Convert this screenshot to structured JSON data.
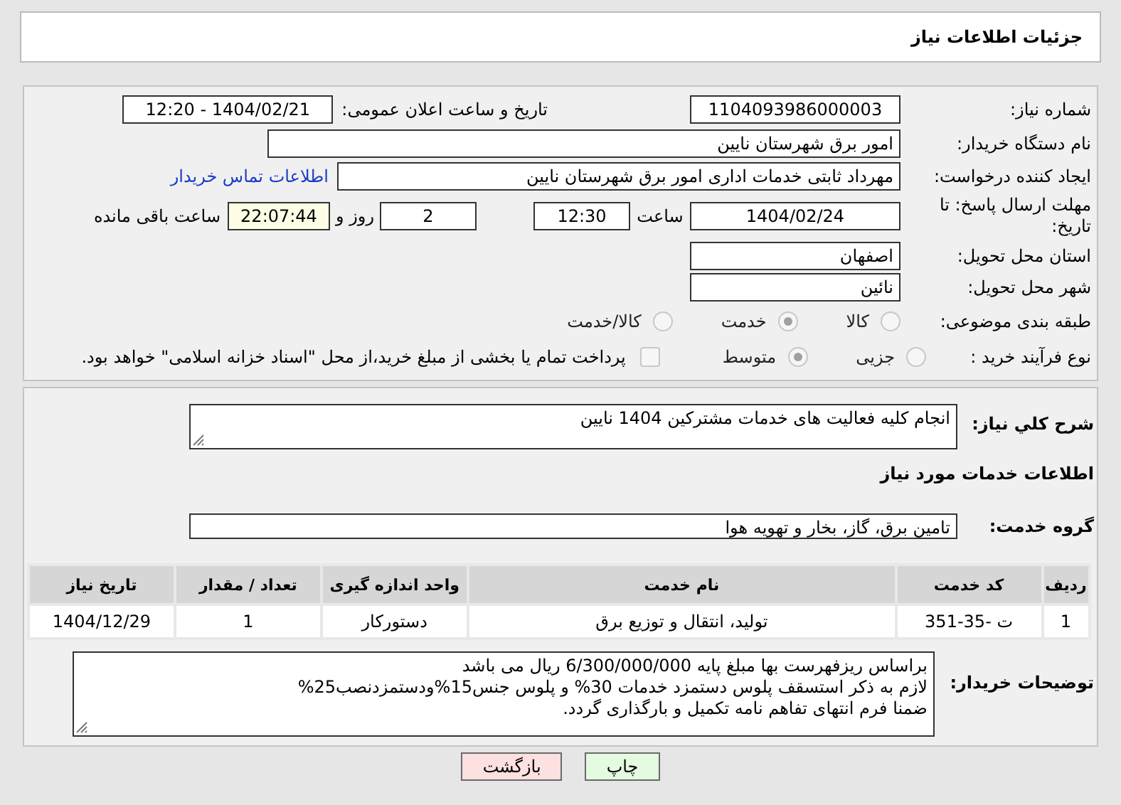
{
  "header": {
    "title": "جزئیات اطلاعات نیاز"
  },
  "need_details": {
    "need_number": {
      "label": "شماره نیاز:",
      "value": "1104093986000003"
    },
    "announce_datetime": {
      "label": "تاریخ و ساعت اعلان عمومی:",
      "value": "1404/02/21 - 12:20"
    },
    "buyer_org": {
      "label": "نام دستگاه خریدار:",
      "value": "امور برق شهرستان نایین"
    },
    "requester": {
      "label": "ایجاد کننده درخواست:",
      "value": "مهرداد ثابتی خدمات اداری امور برق شهرستان نایین",
      "contact_link": "اطلاعات تماس خریدار"
    },
    "deadline": {
      "label": "مهلت ارسال پاسخ: تا تاریخ:",
      "date": "1404/02/24",
      "time_label": "ساعت",
      "time": "12:30",
      "days": "2",
      "days_label": "روز و",
      "remaining": "22:07:44",
      "remaining_label": "ساعت باقی مانده"
    },
    "province": {
      "label": "استان محل تحویل:",
      "value": "اصفهان"
    },
    "city": {
      "label": "شهر محل تحویل:",
      "value": "نائین"
    },
    "category": {
      "label": "طبقه بندی موضوعی:",
      "options": [
        {
          "label": "کالا",
          "selected": false
        },
        {
          "label": "خدمت",
          "selected": true
        },
        {
          "label": "کالا/خدمت",
          "selected": false
        }
      ]
    },
    "purchase_process": {
      "label": "نوع فرآیند خرید :",
      "options": [
        {
          "label": "جزیی",
          "selected": false
        },
        {
          "label": "متوسط",
          "selected": true
        }
      ],
      "treasury_payment": {
        "label": "پرداخت تمام یا بخشی از مبلغ خرید،از محل \"اسناد خزانه اسلامی\" خواهد بود.",
        "checked": false
      }
    }
  },
  "need_summary": {
    "label": "شرح کلي نیاز:",
    "value": "انجام کلیه فعالیت های خدمات مشترکین 1404 نایین"
  },
  "services": {
    "title": "اطلاعات خدمات مورد نیاز",
    "group": {
      "label": "گروه خدمت:",
      "value": "تامین برق، گاز، بخار و تهویه هوا"
    },
    "table": {
      "columns": [
        "ردیف",
        "کد خدمت",
        "نام خدمت",
        "واحد اندازه گیری",
        "تعداد / مقدار",
        "تاریخ نیاز"
      ],
      "rows": [
        [
          "1",
          "ت -35-351",
          "تولید، انتقال و توزیع برق",
          "دستورکار",
          "1",
          "1404/12/29"
        ]
      ]
    }
  },
  "buyer_notes": {
    "label": "توضیحات خریدار:",
    "value": "براساس ریزفهرست بها مبلغ پایه 6/300/000/000 ریال می باشد\nلازم به ذکر استسقف پلوس دستمزد خدمات 30% و پلوس جنس15%ودستمزدنصب25%\nضمنا فرم انتهای تفاهم نامه تکمیل و بارگذاری گردد."
  },
  "buttons": [
    {
      "label": "چاپ",
      "kind": "print"
    },
    {
      "label": "بازگشت",
      "kind": "back"
    }
  ]
}
